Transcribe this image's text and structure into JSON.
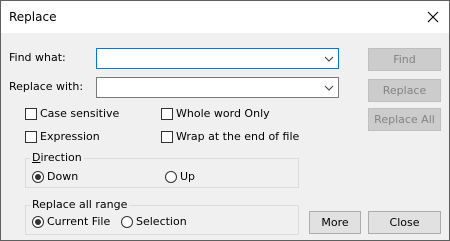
{
  "window": {
    "title": "Replace"
  },
  "find": {
    "label": "Find what:",
    "value": "",
    "placeholder": ""
  },
  "replace": {
    "label": "Replace with:",
    "value": "",
    "placeholder": ""
  },
  "options": {
    "case_sensitive": {
      "label": "Case sensitive",
      "checked": false
    },
    "whole_word": {
      "label": "Whole word Only",
      "checked": false
    },
    "expression": {
      "label": "Expression",
      "checked": false
    },
    "wrap": {
      "label": "Wrap at the end of file",
      "checked": false
    }
  },
  "direction": {
    "title_first": "D",
    "title_rest": "irection",
    "down_label": "Down",
    "up_label": "Up",
    "selected": "Down"
  },
  "range": {
    "title": "Replace all range",
    "current_file_label": "Current File",
    "selection_label": "Selection",
    "selected": "Current File"
  },
  "buttons": {
    "find": "Find",
    "replace": "Replace",
    "replace_all": "Replace All",
    "more": "More",
    "close": "Close"
  },
  "colors": {
    "accent_border": "#0078d7",
    "dialog_bg": "#f0f0f0",
    "disabled_text": "#838383"
  },
  "icons": {
    "close": "close-icon",
    "dropdown": "chevron-down-icon"
  }
}
